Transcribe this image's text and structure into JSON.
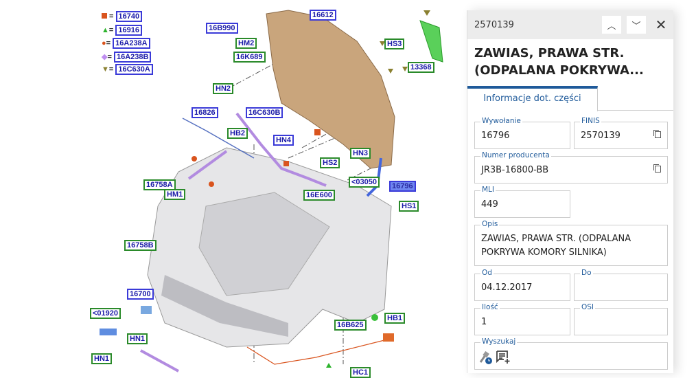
{
  "legend": [
    {
      "shape": "square",
      "color": "#d9541e",
      "code": "16740"
    },
    {
      "shape": "triangle",
      "color": "#2db32d",
      "code": "16916"
    },
    {
      "shape": "circle",
      "color": "#d9541e",
      "code": "16A238A"
    },
    {
      "shape": "diamond",
      "color": "#c08ef0",
      "code": "16A238B"
    },
    {
      "shape": "triangle-down",
      "color": "#8a8030",
      "code": "16C630A"
    }
  ],
  "callouts": [
    "16612",
    "16B990",
    "HM2",
    "16K689",
    "HN2",
    "HS3",
    "13368",
    "16826",
    "16C630B",
    "HB2",
    "HN4",
    "HS2",
    "HN3",
    "<03050",
    "16796",
    "16E600",
    "HS1",
    "16758A",
    "HM1",
    "16758B",
    "16700",
    "<01920",
    "HN1",
    "HN1",
    "16B625",
    "HB1",
    "HC1"
  ],
  "panel": {
    "header_id": "2570139",
    "title": "ZAWIAS, PRAWA STR. (ODPALANA POKRYWA...",
    "tab": "Informacje dot. części",
    "fields": {
      "wywolanie": {
        "label": "Wywołanie",
        "value": "16796"
      },
      "finis": {
        "label": "FINIS",
        "value": "2570139"
      },
      "numer": {
        "label": "Numer producenta",
        "value": "JR3B-16800-BB"
      },
      "mli": {
        "label": "MLI",
        "value": "449"
      },
      "opis": {
        "label": "Opis",
        "value": "ZAWIAS, PRAWA STR. (ODPALANA POKRYWA KOMORY SILNIKA)"
      },
      "od": {
        "label": "Od",
        "value": "04.12.2017"
      },
      "do": {
        "label": "Do",
        "value": ""
      },
      "ilosc": {
        "label": "Ilość",
        "value": "1"
      },
      "osi": {
        "label": "OSI",
        "value": ""
      },
      "wyszukaj": {
        "label": "Wyszukaj"
      }
    }
  }
}
